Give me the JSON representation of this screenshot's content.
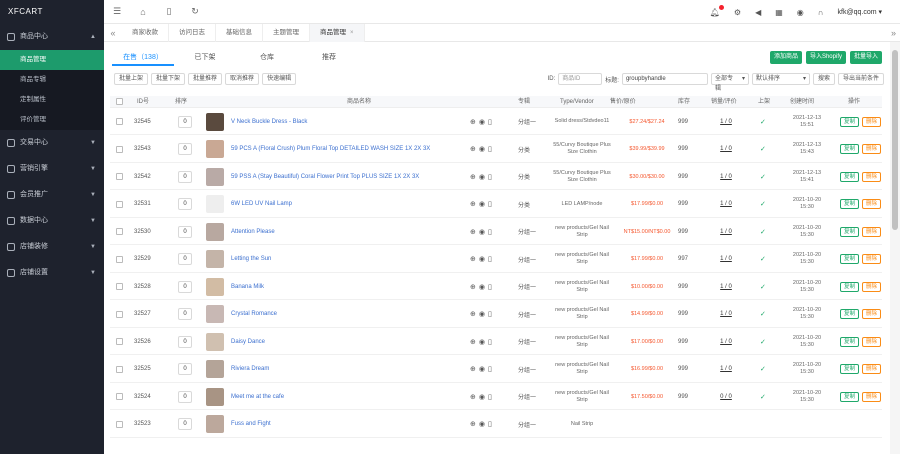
{
  "brand": "XFCART",
  "sidebar": {
    "groups": [
      {
        "label": "商品中心",
        "expanded": true,
        "items": [
          {
            "label": "商品管理",
            "active": true
          },
          {
            "label": "商品专辑",
            "active": false
          },
          {
            "label": "定制属性",
            "active": false
          },
          {
            "label": "评价管理",
            "active": false
          }
        ]
      },
      {
        "label": "交易中心",
        "expanded": false
      },
      {
        "label": "营销引擎",
        "expanded": false
      },
      {
        "label": "会员推广",
        "expanded": false
      },
      {
        "label": "数据中心",
        "expanded": false
      },
      {
        "label": "店铺装修",
        "expanded": false
      },
      {
        "label": "店铺设置",
        "expanded": false
      }
    ]
  },
  "topbar": {
    "user": "kfk@qq.com ▾"
  },
  "page_tabs": [
    {
      "label": "商家收款",
      "active": false
    },
    {
      "label": "访问日志",
      "active": false
    },
    {
      "label": "基础信息",
      "active": false
    },
    {
      "label": "主题管理",
      "active": false
    },
    {
      "label": "商品管理",
      "active": true
    }
  ],
  "status_tabs": [
    {
      "label": "在售（138）",
      "active": true
    },
    {
      "label": "已下架",
      "active": false
    },
    {
      "label": "仓库",
      "active": false
    },
    {
      "label": "推荐",
      "active": false
    }
  ],
  "top_actions": [
    "添加商品",
    "导入Shopify",
    "批量导入"
  ],
  "tools": [
    "批量上架",
    "批量下架",
    "批量推荐",
    "取消推荐",
    "快速编辑"
  ],
  "filters": {
    "id_label": "ID:",
    "id_placeholder": "商品ID",
    "title_label": "标题:",
    "title_value": "groupbyhandle",
    "select_all": "全部专辑",
    "select_sort": "默认排序",
    "search": "搜索",
    "export": "导出当前条件"
  },
  "columns": [
    "ID号",
    "排序",
    "商品名称",
    "专辑",
    "Type/Vendor",
    "售价/原价",
    "库存",
    "销量/评价",
    "上架",
    "创建时间",
    "操作"
  ],
  "rows": [
    {
      "id": "32545",
      "sort": "0",
      "name": "V Neck Buckle Dress - Black",
      "album": "分组一",
      "type": "Solid dress/Stdvdeo11",
      "price": "$27.24/$27.24",
      "stock": "999",
      "sales": "1 / 0",
      "time1": "2021-12-13",
      "time2": "15:51",
      "thumb": "#5a4a3e"
    },
    {
      "id": "32543",
      "sort": "0",
      "name": "59 PCS A (Floral Crush) Plum Floral Top DETAILED WASH SIZE 1X 2X 3X",
      "album": "分类",
      "type": "55/Curvy Boutique Plus Size Clothin",
      "price": "$39.99/$39.99",
      "stock": "999",
      "sales": "1 / 0",
      "time1": "2021-12-13",
      "time2": "15:43",
      "thumb": "#c9a894"
    },
    {
      "id": "32542",
      "sort": "0",
      "name": "59 PSS A (Stay Beautiful) Coral Flower Print Top PLUS SIZE 1X 2X 3X",
      "album": "分类",
      "type": "55/Curvy Boutique Plus Size Clothin",
      "price": "$30.00/$30.00",
      "stock": "999",
      "sales": "1 / 0",
      "time1": "2021-12-13",
      "time2": "15:41",
      "thumb": "#b9aaa6"
    },
    {
      "id": "32531",
      "sort": "0",
      "name": "6W LED UV Nail Lamp",
      "album": "分类",
      "type": "LED LAMP/node",
      "price": "$17.99/$0.00",
      "stock": "999",
      "sales": "1 / 0",
      "time1": "2021-10-20",
      "time2": "15:30",
      "thumb": "#eeeeee"
    },
    {
      "id": "32530",
      "sort": "0",
      "name": "Attention Please",
      "album": "分组一",
      "type": "new products/Gel Nail Strip",
      "price": "NT$15.00/NT$0.00",
      "stock": "999",
      "sales": "1 / 0",
      "time1": "2021-10-20",
      "time2": "15:30",
      "thumb": "#b8a8a0"
    },
    {
      "id": "32529",
      "sort": "0",
      "name": "Letting the Sun",
      "album": "分组一",
      "type": "new products/Gel Nail Strip",
      "price": "$17.99/$0.00",
      "stock": "997",
      "sales": "1 / 0",
      "time1": "2021-10-20",
      "time2": "15:30",
      "thumb": "#c4b4a8"
    },
    {
      "id": "32528",
      "sort": "0",
      "name": "Banana Milk",
      "album": "分组一",
      "type": "new products/Gel Nail Strip",
      "price": "$10.00/$0.00",
      "stock": "999",
      "sales": "1 / 0",
      "time1": "2021-10-20",
      "time2": "15:30",
      "thumb": "#d2bca4"
    },
    {
      "id": "32527",
      "sort": "0",
      "name": "Crystal Romance",
      "album": "分组一",
      "type": "new products/Gel Nail Strip",
      "price": "$14.99/$0.00",
      "stock": "999",
      "sales": "1 / 0",
      "time1": "2021-10-20",
      "time2": "15:30",
      "thumb": "#c8b8b4"
    },
    {
      "id": "32526",
      "sort": "0",
      "name": "Daisy Dance",
      "album": "分组一",
      "type": "new products/Gel Nail Strip",
      "price": "$17.00/$0.00",
      "stock": "999",
      "sales": "1 / 0",
      "time1": "2021-10-20",
      "time2": "15:30",
      "thumb": "#d0c0b0"
    },
    {
      "id": "32525",
      "sort": "0",
      "name": "Riviera Dream",
      "album": "分组一",
      "type": "new products/Gel Nail Strip",
      "price": "$16.99/$0.00",
      "stock": "999",
      "sales": "1 / 0",
      "time1": "2021-10-20",
      "time2": "15:30",
      "thumb": "#b4a498"
    },
    {
      "id": "32524",
      "sort": "0",
      "name": "Meet me at the cafe",
      "album": "分组一",
      "type": "new products/Gel Nail Strip",
      "price": "$17.50/$0.00",
      "stock": "999",
      "sales": "0 / 0",
      "time1": "2021-10-20",
      "time2": "15:30",
      "thumb": "#a89484"
    },
    {
      "id": "32523",
      "sort": "0",
      "name": "Fuss and Fight",
      "album": "分组一",
      "type": "Nail Strip",
      "price": "",
      "stock": "",
      "sales": "",
      "time1": "",
      "time2": "",
      "thumb": "#bca89c"
    }
  ],
  "ops": {
    "edit": "复制",
    "del": "删除"
  },
  "colors": {
    "accent_green": "#1fa86a",
    "active_blue": "#1890ff",
    "sidebar_bg": "#1e222d",
    "price_red": "#f5562d"
  }
}
